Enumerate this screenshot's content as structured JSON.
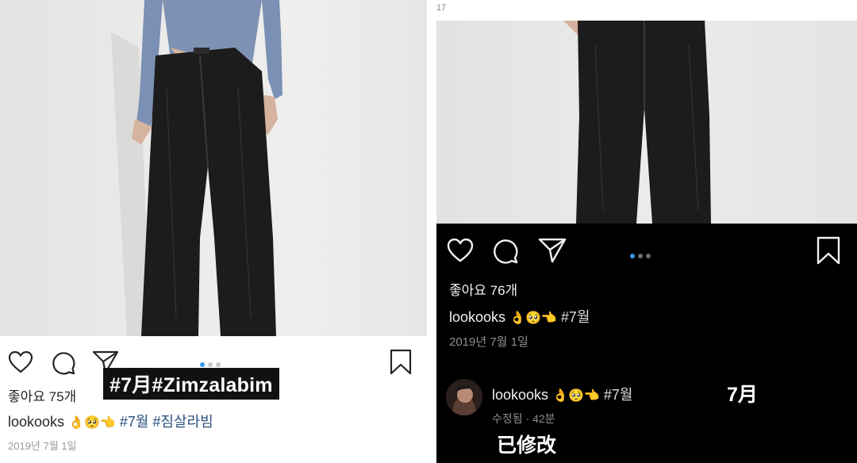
{
  "left_post": {
    "likes": "좋아요 75개",
    "username": "lookooks",
    "emojis": "👌🥺👈",
    "hashtags": "#7월 #짐살라빔",
    "date": "2019년 7월 1일",
    "overlay_label": "#7月#Zimzalabim",
    "carousel_dots": 3,
    "carousel_active": 1,
    "colors": {
      "text": "#262626",
      "hashtag": "#2a4f7d",
      "dot_active": "#3897f0",
      "dot_inactive": "#c7c7c7"
    }
  },
  "right_post": {
    "corner_text": "17",
    "likes": "좋아요 76개",
    "username": "lookooks",
    "emojis": "👌🥺👈",
    "hashtag": "#7월",
    "date": "2019년 7월 1일",
    "comment": {
      "username": "lookooks",
      "emojis": "👌🥺👈",
      "hashtag": "#7월",
      "meta": "수정됨 · 42분"
    },
    "overlay_month": "7月",
    "overlay_edited": "已修改",
    "carousel_dots": 3,
    "carousel_active": 1,
    "colors": {
      "background": "#000000",
      "text": "#f2f2f2",
      "muted": "#8e8e8e",
      "dot_active": "#3897f0"
    }
  },
  "icons": [
    "heart-icon",
    "comment-icon",
    "share-icon",
    "bookmark-icon"
  ]
}
